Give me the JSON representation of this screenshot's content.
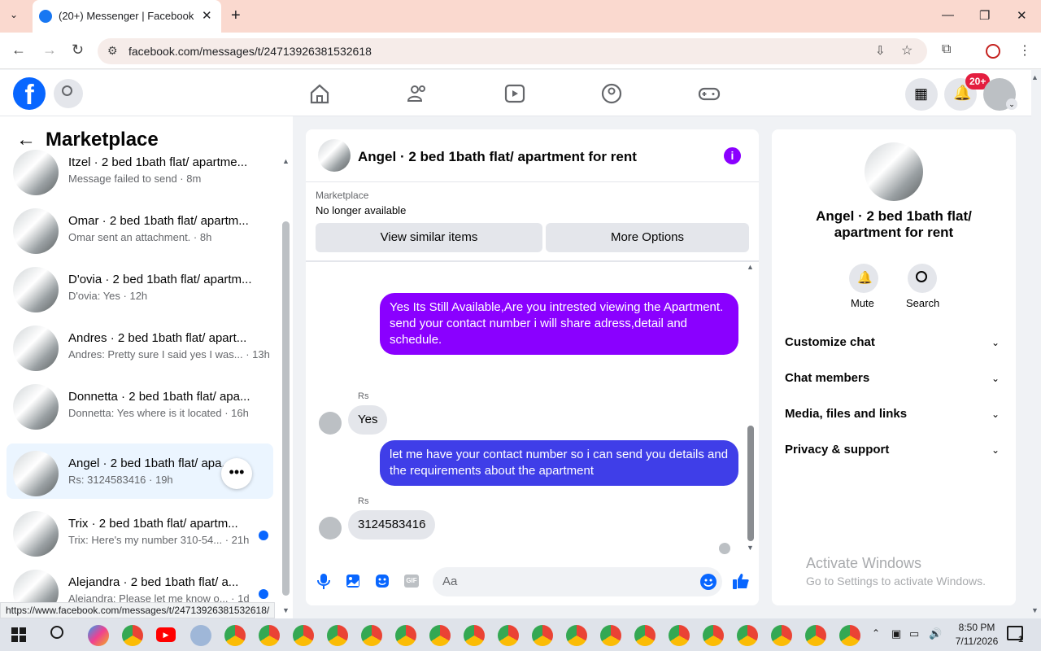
{
  "browser": {
    "tab_title": "(20+) Messenger | Facebook",
    "url": "facebook.com/messages/t/24713926381532618",
    "status_url": "https://www.facebook.com/messages/t/24713926381532618/"
  },
  "header": {
    "notif_badge": "20+"
  },
  "left": {
    "title": "Marketplace",
    "items": [
      {
        "name": "Itzel · 2 bed 1bath flat/ apartme...",
        "sub": "Message failed to send · 8m",
        "unread": false
      },
      {
        "name": "Omar · 2 bed 1bath flat/ apartm...",
        "sub": "Omar sent an attachment. · 8h",
        "unread": false
      },
      {
        "name": "D'ovia · 2 bed 1bath flat/ apartm...",
        "sub": "D'ovia: Yes · 12h",
        "unread": false
      },
      {
        "name": "Andres · 2 bed 1bath flat/ apart...",
        "sub": "Andres: Pretty sure I said yes I was... · 13h",
        "unread": false
      },
      {
        "name": "Donnetta · 2 bed 1bath flat/ apa...",
        "sub": "Donnetta: Yes where is it located · 16h",
        "unread": false
      },
      {
        "name": "Angel · 2 bed 1bath flat/ apa...",
        "sub": "Rs: 3124583416 · 19h",
        "unread": false
      },
      {
        "name": "Trix · 2 bed 1bath flat/ apartm...",
        "sub": "Trix: Here's my number 310-54... · 21h",
        "unread": true
      },
      {
        "name": "Alejandra · 2 bed 1bath flat/ a...",
        "sub": "Alejandra: Please let me know o... · 1d",
        "unread": true
      }
    ]
  },
  "chat": {
    "title": "Angel · 2 bed 1bath flat/ apartment for rent",
    "marketplace_label": "Marketplace",
    "status": "No longer available",
    "btn_similar": "View similar items",
    "btn_more": "More Options",
    "messages": [
      {
        "text": "Yes Its Still Available,Are you intrested viewing the Apartment. send your contact number i will share adress,detail and schedule."
      },
      {
        "sender": "Rs",
        "text": "Yes"
      },
      {
        "text": "let me have your contact number so i can send you details and the requirements about the apartment"
      },
      {
        "sender": "Rs",
        "text": "3124583416"
      }
    ],
    "composer_placeholder": "Aa"
  },
  "right": {
    "title": "Angel · 2 bed 1bath flat/ apartment for rent",
    "mute_label": "Mute",
    "search_label": "Search",
    "sections": [
      "Customize chat",
      "Chat members",
      "Media, files and links",
      "Privacy & support"
    ],
    "watermark_title": "Activate Windows",
    "watermark_sub": "Go to Settings to activate Windows."
  },
  "taskbar": {
    "time": "8:50 PM",
    "date": "7/11/2026",
    "notif_count": "1"
  },
  "colors": {
    "accent": "#0866ff",
    "bubble_purple": "#8a00ff",
    "bubble_blue": "#3f3ee8",
    "tab_bg": "#fad9cf"
  }
}
